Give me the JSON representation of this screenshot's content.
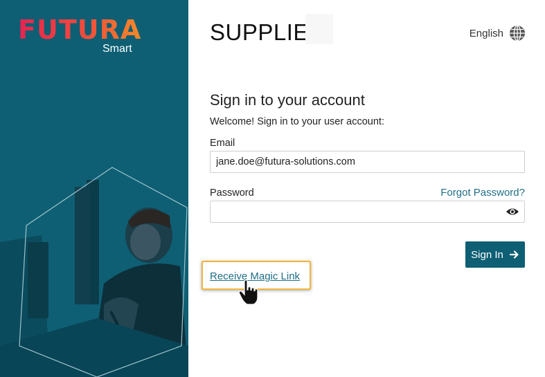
{
  "brand": {
    "logo_word": "FUTURA",
    "logo_sub": "Smart",
    "panel_color": "#0e5f74",
    "logo_gradient": [
      "#e8234f",
      "#f48a2a"
    ]
  },
  "header": {
    "app_title": "SUPPLIER",
    "language": "English",
    "language_icon": "globe-icon"
  },
  "signin": {
    "heading": "Sign in to your account",
    "welcome": "Welcome! Sign in to your user account:",
    "email_label": "Email",
    "email_value": "jane.doe@futura-solutions.com",
    "password_label": "Password",
    "password_value": "",
    "forgot_password": "Forgot Password?",
    "show_password_icon": "eye-icon",
    "submit_label": "Sign In",
    "submit_icon": "arrow-right-icon",
    "magic_link": "Receive Magic Link",
    "highlight_color": "#f2b43b",
    "link_color": "#1f6f86"
  }
}
